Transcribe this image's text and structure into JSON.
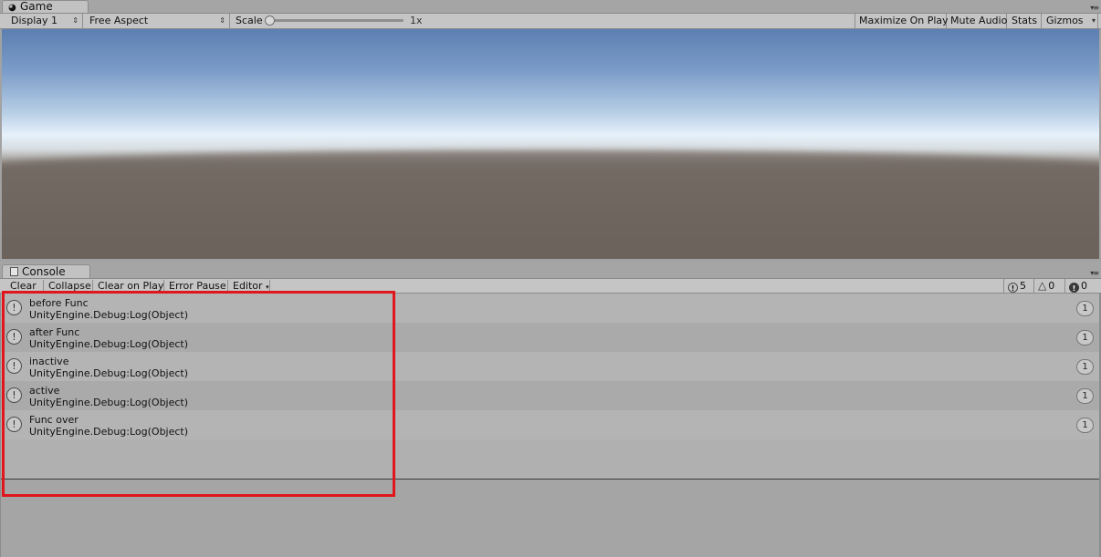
{
  "game": {
    "tab_title": "Game",
    "toolbar": {
      "display": "Display 1",
      "aspect": "Free Aspect",
      "scale_label": "Scale",
      "scale_value": "1x",
      "maximize_on_play": "Maximize On Play",
      "mute_audio": "Mute Audio",
      "stats": "Stats",
      "gizmos": "Gizmos"
    }
  },
  "console": {
    "tab_title": "Console",
    "toolbar": {
      "clear": "Clear",
      "collapse": "Collapse",
      "clear_on_play": "Clear on Play",
      "error_pause": "Error Pause",
      "editor": "Editor"
    },
    "counters": {
      "info": "5",
      "warnings": "0",
      "errors": "0"
    },
    "entries": [
      {
        "message": "before Func",
        "trace": "UnityEngine.Debug:Log(Object)",
        "count": "1"
      },
      {
        "message": "after Func",
        "trace": "UnityEngine.Debug:Log(Object)",
        "count": "1"
      },
      {
        "message": "inactive",
        "trace": "UnityEngine.Debug:Log(Object)",
        "count": "1"
      },
      {
        "message": "active",
        "trace": "UnityEngine.Debug:Log(Object)",
        "count": "1"
      },
      {
        "message": "Func over",
        "trace": "UnityEngine.Debug:Log(Object)",
        "count": "1"
      }
    ]
  },
  "colors": {
    "highlight_box": "#e0161c"
  },
  "icons": {
    "game_tab": "pacman-icon",
    "console_tab": "console-icon",
    "log_entry": "info-icon"
  }
}
